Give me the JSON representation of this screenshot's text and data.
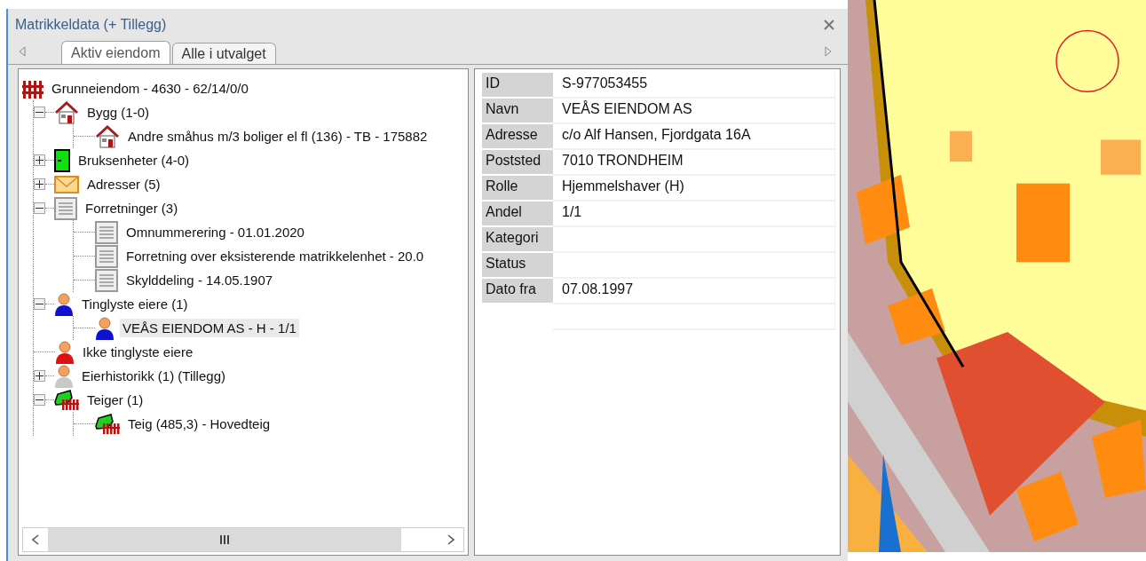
{
  "window": {
    "title": "Matrikkeldata (+ Tillegg)"
  },
  "tabs": [
    {
      "label": "Aktiv eiendom",
      "selected": true
    },
    {
      "label": "Alle i utvalget",
      "selected": false
    }
  ],
  "tree": [
    {
      "label": "Grunneiendom - 4630 - 62/14/0/0",
      "kind": "property",
      "selected": false,
      "children": [
        {
          "label": "Bygg (1-0)",
          "kind": "house",
          "expanded": true,
          "selected": false,
          "children": [
            {
              "label": "Andre småhus m/3 boliger el fl (136) - TB - 175882",
              "kind": "house",
              "selected": false
            }
          ]
        },
        {
          "label": "Bruksenheter (4-0)",
          "kind": "unit",
          "expanded": false,
          "selected": false
        },
        {
          "label": "Adresser (5)",
          "kind": "envelope",
          "expanded": false,
          "selected": false
        },
        {
          "label": "Forretninger (3)",
          "kind": "document",
          "expanded": true,
          "selected": false,
          "children": [
            {
              "label": "Omnummerering - 01.01.2020",
              "kind": "document",
              "selected": false
            },
            {
              "label": "Forretning over eksisterende matrikkelenhet - 20.0",
              "kind": "document",
              "selected": false
            },
            {
              "label": "Skylddeling - 14.05.1907",
              "kind": "document",
              "selected": false
            }
          ]
        },
        {
          "label": "Tinglyste eiere (1)",
          "kind": "person-blue",
          "expanded": true,
          "selected": false,
          "children": [
            {
              "label": "VEÅS EIENDOM AS - H - 1/1",
              "kind": "person-blue",
              "selected": true
            }
          ]
        },
        {
          "label": "Ikke tinglyste eiere",
          "kind": "person-red",
          "selected": false
        },
        {
          "label": "Eierhistorikk (1) (Tillegg)",
          "kind": "person-grey",
          "expanded": false,
          "selected": false
        },
        {
          "label": "Teiger (1)",
          "kind": "parcel",
          "expanded": true,
          "selected": false,
          "children": [
            {
              "label": "Teig (485,3) - Hovedteig",
              "kind": "parcel",
              "selected": false
            }
          ]
        }
      ]
    }
  ],
  "details": [
    {
      "label": "ID",
      "value": "S-977053455"
    },
    {
      "label": "Navn",
      "value": "VEÅS EIENDOM AS"
    },
    {
      "label": "Adresse",
      "value": "c/o Alf Hansen, Fjordgata 16A"
    },
    {
      "label": "Poststed",
      "value": "7010 TRONDHEIM"
    },
    {
      "label": "Rolle",
      "value": "Hjemmelshaver (H)"
    },
    {
      "label": "Andel",
      "value": "1/1"
    },
    {
      "label": "Kategori"
    },
    {
      "label": "Status"
    },
    {
      "label": "Dato fra",
      "value": "07.08.1997"
    }
  ]
}
